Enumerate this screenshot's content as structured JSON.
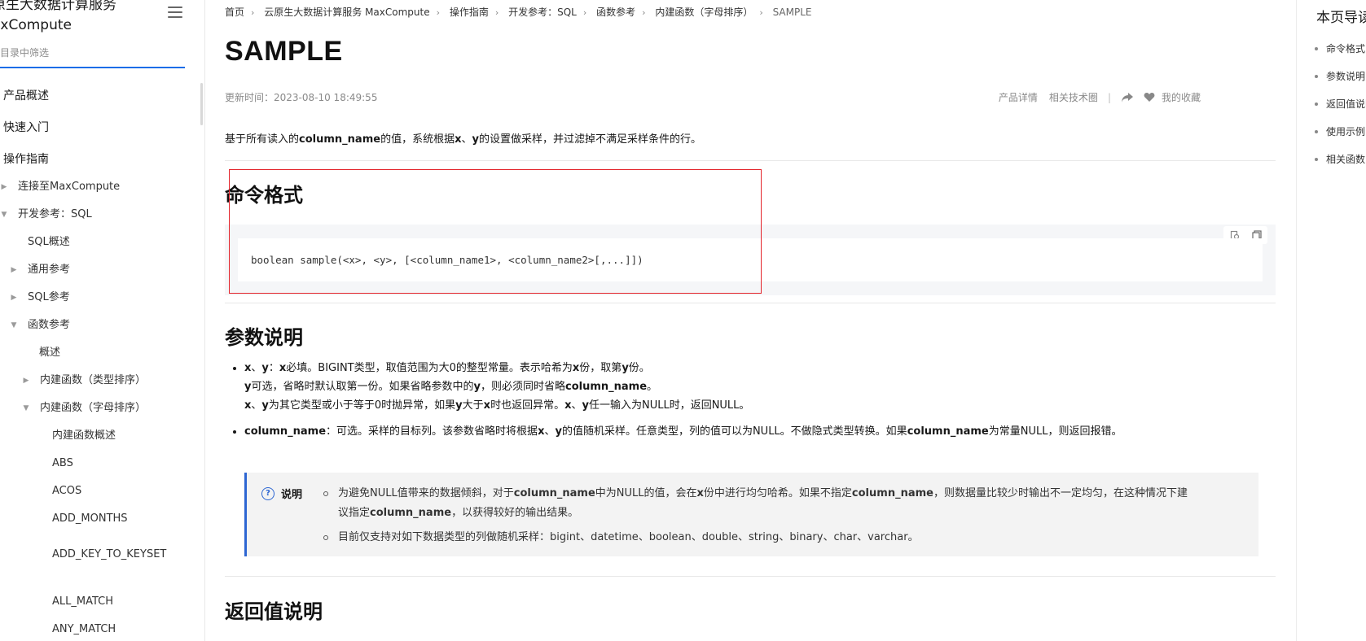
{
  "sidebar": {
    "title_line1": "原生大数据计算服务",
    "title_line2": "axCompute",
    "filter_placeholder": "在目录中筛选",
    "items": [
      {
        "label": "产品概述"
      },
      {
        "label": "快速入门"
      },
      {
        "label": "操作指南"
      },
      {
        "label": "连接至MaxCompute"
      },
      {
        "label": "开发参考：SQL"
      },
      {
        "label": "SQL概述"
      },
      {
        "label": "通用参考"
      },
      {
        "label": "SQL参考"
      },
      {
        "label": "函数参考"
      },
      {
        "label": "概述"
      },
      {
        "label": "内建函数（类型排序）"
      },
      {
        "label": "内建函数（字母排序）"
      },
      {
        "label": "内建函数概述"
      },
      {
        "label": "ABS"
      },
      {
        "label": "ACOS"
      },
      {
        "label": "ADD_MONTHS"
      },
      {
        "label": "ADD_KEY_TO_KEYSET"
      },
      {
        "label": "ALL_MATCH"
      },
      {
        "label": "ANY_MATCH"
      }
    ]
  },
  "breadcrumb": [
    "首页",
    "云原生大数据计算服务 MaxCompute",
    "操作指南",
    "开发参考：SQL",
    "函数参考",
    "内建函数（字母排序）",
    "SAMPLE"
  ],
  "page": {
    "title": "SAMPLE",
    "updated": "更新时间：2023-08-10 18:49:55",
    "actions": {
      "product": "产品详情",
      "forum": "相关技术圈",
      "divider": "|",
      "favorite": "我的收藏"
    },
    "intro_1": "基于所有读入的",
    "intro_2": "column_name",
    "intro_3": "的值，系统根据",
    "intro_4": "x",
    "intro_5": "、",
    "intro_6": "y",
    "intro_7": "的设置做采样，并过滤掉不满足采样条件的行。"
  },
  "sections": {
    "syntax": "命令格式",
    "params": "参数说明",
    "returns": "返回值说明"
  },
  "code": "boolean sample(<x>, <y>, [<column_name1>, <column_name2>[,...]])",
  "params": {
    "p1_l1_a": "x",
    "p1_l1_b": "、",
    "p1_l1_c": "y",
    "p1_l1_d": "：",
    "p1_l1_e": "x",
    "p1_l1_f": "必填。BIGINT类型，取值范围为大0的整型常量。表示哈希为",
    "p1_l1_g": "x",
    "p1_l1_h": "份，取第",
    "p1_l1_i": "y",
    "p1_l1_j": "份。",
    "p1_l2_a": "y",
    "p1_l2_b": "可选，省略时默认取第一份。如果省略参数中的",
    "p1_l2_c": "y",
    "p1_l2_d": "，则必须同时省略",
    "p1_l2_e": "column_name",
    "p1_l2_f": "。",
    "p1_l3_a": "x",
    "p1_l3_b": "、",
    "p1_l3_c": "y",
    "p1_l3_d": "为其它类型或小于等于0时抛异常，如果",
    "p1_l3_e": "y",
    "p1_l3_f": "大于",
    "p1_l3_g": "x",
    "p1_l3_h": "时也返回异常。",
    "p1_l3_i": "x",
    "p1_l3_j": "、",
    "p1_l3_k": "y",
    "p1_l3_l": "任一输入为NULL时，返回NULL。",
    "p2_a": "column_name",
    "p2_b": "：可选。采样的目标列。该参数省略时将根据",
    "p2_c": "x",
    "p2_d": "、",
    "p2_e": "y",
    "p2_f": "的值随机采样。任意类型，列的值可以为NULL。不做隐式类型转换。如果",
    "p2_g": "column_name",
    "p2_h": "为常量NULL，则返回报错。"
  },
  "note": {
    "label": "说明",
    "n1_a": "为避免NULL值带来的数据倾斜，对于",
    "n1_b": "column_name",
    "n1_c": "中为NULL的值，会在",
    "n1_d": "x",
    "n1_e": "份中进行均匀哈希。如果不指定",
    "n1_f": "column_name",
    "n1_g": "，则数据量比较少时输出不一定均匀，在这种情况下建",
    "n1_h": "议指定",
    "n1_i": "column_name",
    "n1_j": "，以获得较好的输出结果。",
    "n2": "目前仅支持对如下数据类型的列做随机采样：bigint、datetime、boolean、double、string、binary、char、varchar。"
  },
  "toc": {
    "title": "本页导读",
    "items": [
      "命令格式",
      "参数说明",
      "返回值说明",
      "使用示例",
      "相关函数"
    ]
  },
  "colors": {
    "accent": "#1b6de8",
    "note_border": "#2d66d2",
    "highlight": "#e3242b"
  }
}
